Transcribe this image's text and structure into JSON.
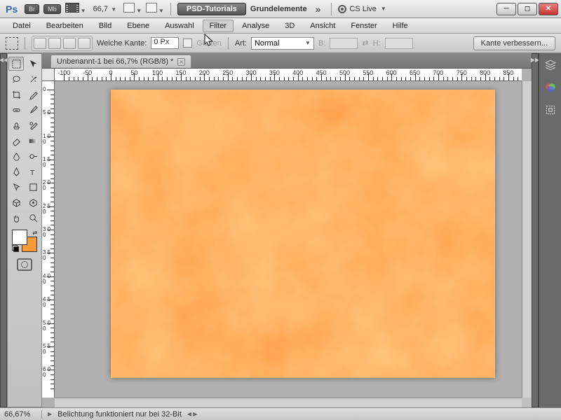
{
  "titlebar": {
    "app": "Ps",
    "br": "Br",
    "mb": "Mb",
    "zoom": "66,7",
    "workspace_pill": "PSD-Tutorials",
    "workspace_txt": "Grundelemente",
    "cs_live": "CS Live"
  },
  "menu": [
    "Datei",
    "Bearbeiten",
    "Bild",
    "Ebene",
    "Auswahl",
    "Filter",
    "Analyse",
    "3D",
    "Ansicht",
    "Fenster",
    "Hilfe"
  ],
  "options": {
    "feather_label": "Weiche Kante:",
    "feather_value": "0 Px",
    "antialias": "Glätten",
    "style_label": "Art:",
    "style_value": "Normal",
    "w": "B:",
    "h": "H:",
    "refine": "Kante verbessern..."
  },
  "tab": "Unbenannt-1 bei 66,7% (RGB/8) *",
  "ruler_h": [
    -100,
    -50,
    0,
    50,
    100,
    150,
    200,
    250,
    300,
    350,
    400,
    450,
    500,
    550,
    600,
    650,
    700,
    750,
    800,
    850
  ],
  "ruler_v": [
    0,
    50,
    100,
    150,
    200,
    250,
    300,
    350,
    400,
    450,
    500,
    550,
    600
  ],
  "status": {
    "zoom": "66,67%",
    "msg": "Belichtung funktioniert nur bei 32-Bit"
  },
  "colors": {
    "fg": "#ffffff",
    "bg": "#ff9933"
  }
}
